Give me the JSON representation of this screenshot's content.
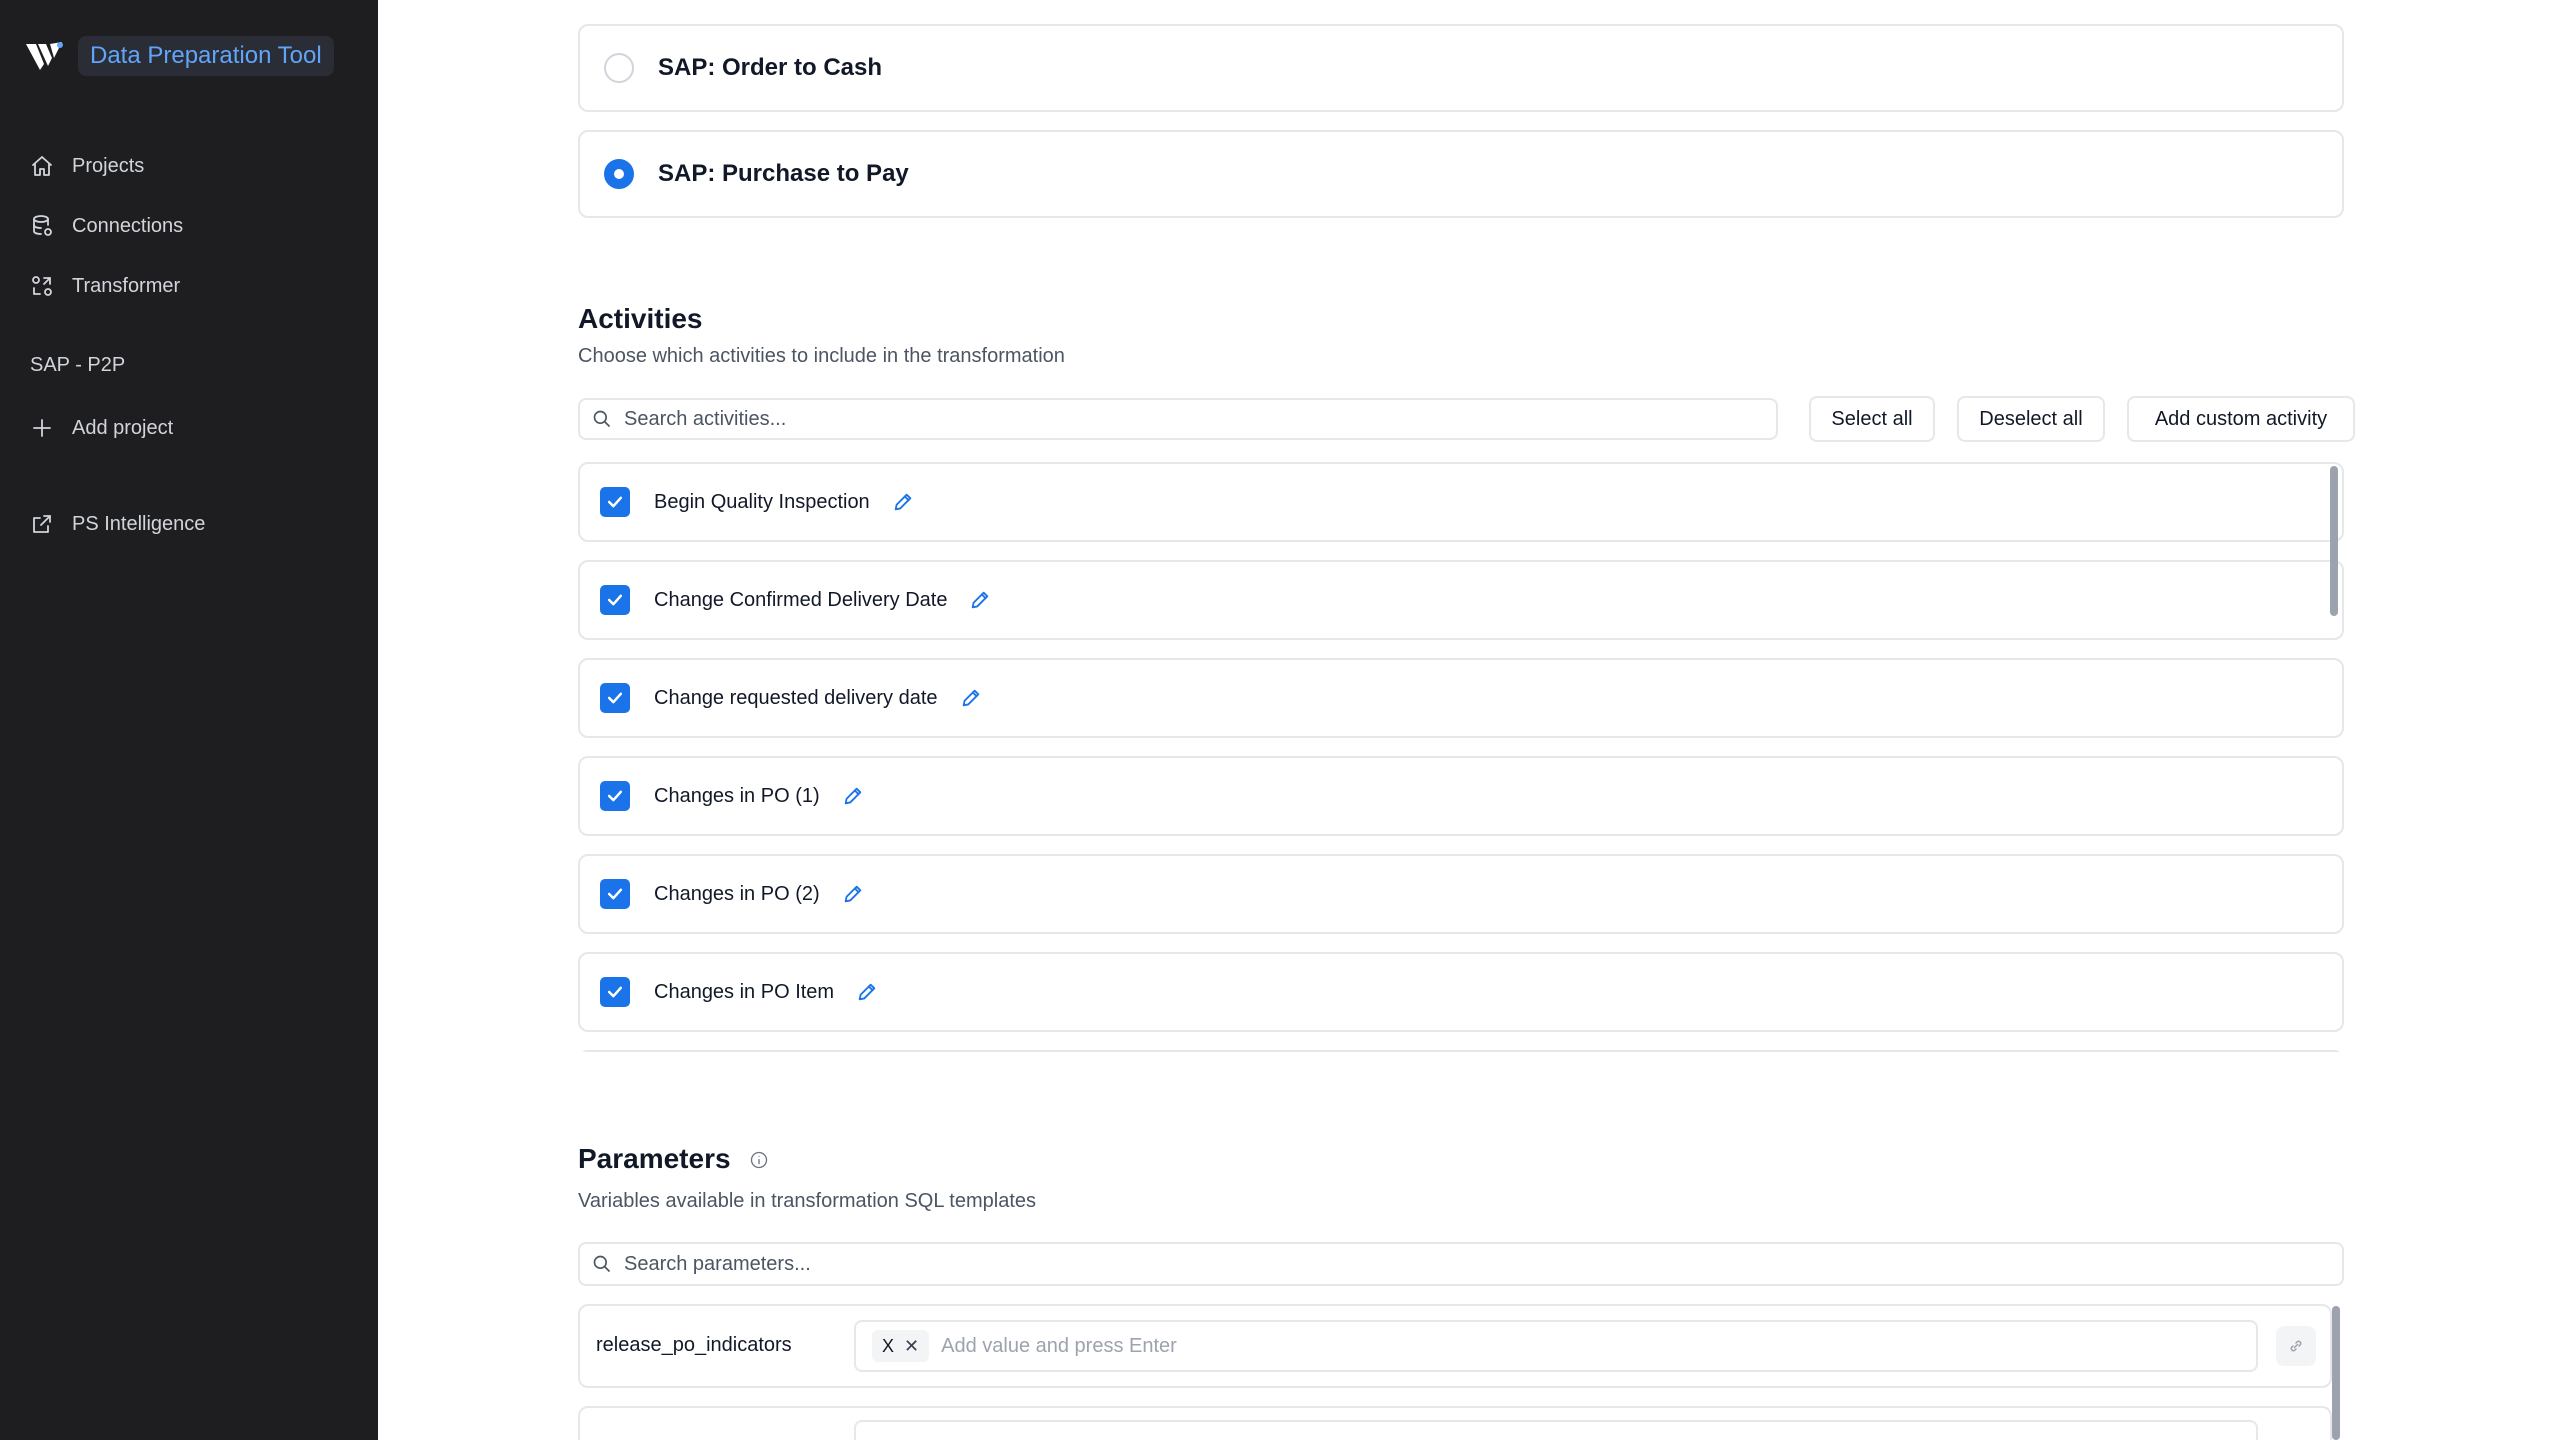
{
  "app": {
    "title": "Data Preparation Tool"
  },
  "sidebar": {
    "items": [
      {
        "label": "Projects",
        "icon": "home-icon"
      },
      {
        "label": "Connections",
        "icon": "database-icon"
      },
      {
        "label": "Transformer",
        "icon": "transform-icon"
      }
    ],
    "section_label": "SAP - P2P",
    "add_project_label": "Add project",
    "external_link_label": "PS Intelligence"
  },
  "process_options": [
    {
      "label": "SAP: Order to Cash",
      "selected": false
    },
    {
      "label": "SAP: Purchase to Pay",
      "selected": true
    }
  ],
  "activities": {
    "title": "Activities",
    "subtitle": "Choose which activities to include in the transformation",
    "search_placeholder": "Search activities...",
    "buttons": {
      "select_all": "Select all",
      "deselect_all": "Deselect all",
      "add_custom": "Add custom activity"
    },
    "items": [
      {
        "label": "Begin Quality Inspection",
        "checked": true
      },
      {
        "label": "Change Confirmed Delivery Date",
        "checked": true
      },
      {
        "label": "Change requested delivery date",
        "checked": true
      },
      {
        "label": "Changes in PO (1)",
        "checked": true
      },
      {
        "label": "Changes in PO (2)",
        "checked": true
      },
      {
        "label": "Changes in PO Item",
        "checked": true
      }
    ]
  },
  "parameters": {
    "title": "Parameters",
    "subtitle": "Variables available in transformation SQL templates",
    "search_placeholder": "Search parameters...",
    "rows": [
      {
        "name": "release_po_indicators",
        "chips": [
          "X"
        ],
        "placeholder": "Add value and press Enter"
      }
    ]
  },
  "colors": {
    "accent": "#1a73e8",
    "sidebar_bg": "#1e1e20",
    "brand_text": "#60a5fa"
  }
}
